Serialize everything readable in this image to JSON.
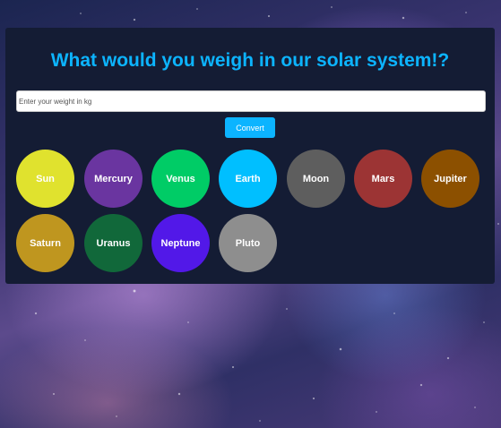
{
  "header": {
    "title": "What would you weigh in our solar system!?"
  },
  "form": {
    "weight_placeholder": "Enter your weight in kg",
    "weight_value": "",
    "convert_label": "Convert"
  },
  "planets": [
    {
      "label": "Sun",
      "color": "#e0e22e"
    },
    {
      "label": "Mercury",
      "color": "#6a35a0"
    },
    {
      "label": "Venus",
      "color": "#00cc66"
    },
    {
      "label": "Earth",
      "color": "#00bfff"
    },
    {
      "label": "Moon",
      "color": "#5e5e5e"
    },
    {
      "label": "Mars",
      "color": "#9c3434"
    },
    {
      "label": "Jupiter",
      "color": "#8c5000"
    },
    {
      "label": "Saturn",
      "color": "#bf961f"
    },
    {
      "label": "Uranus",
      "color": "#11683a"
    },
    {
      "label": "Neptune",
      "color": "#5218e8"
    },
    {
      "label": "Pluto",
      "color": "#8e8e8e"
    }
  ],
  "theme": {
    "accent": "#0cb4ff",
    "panel_bg": "#141c34"
  }
}
